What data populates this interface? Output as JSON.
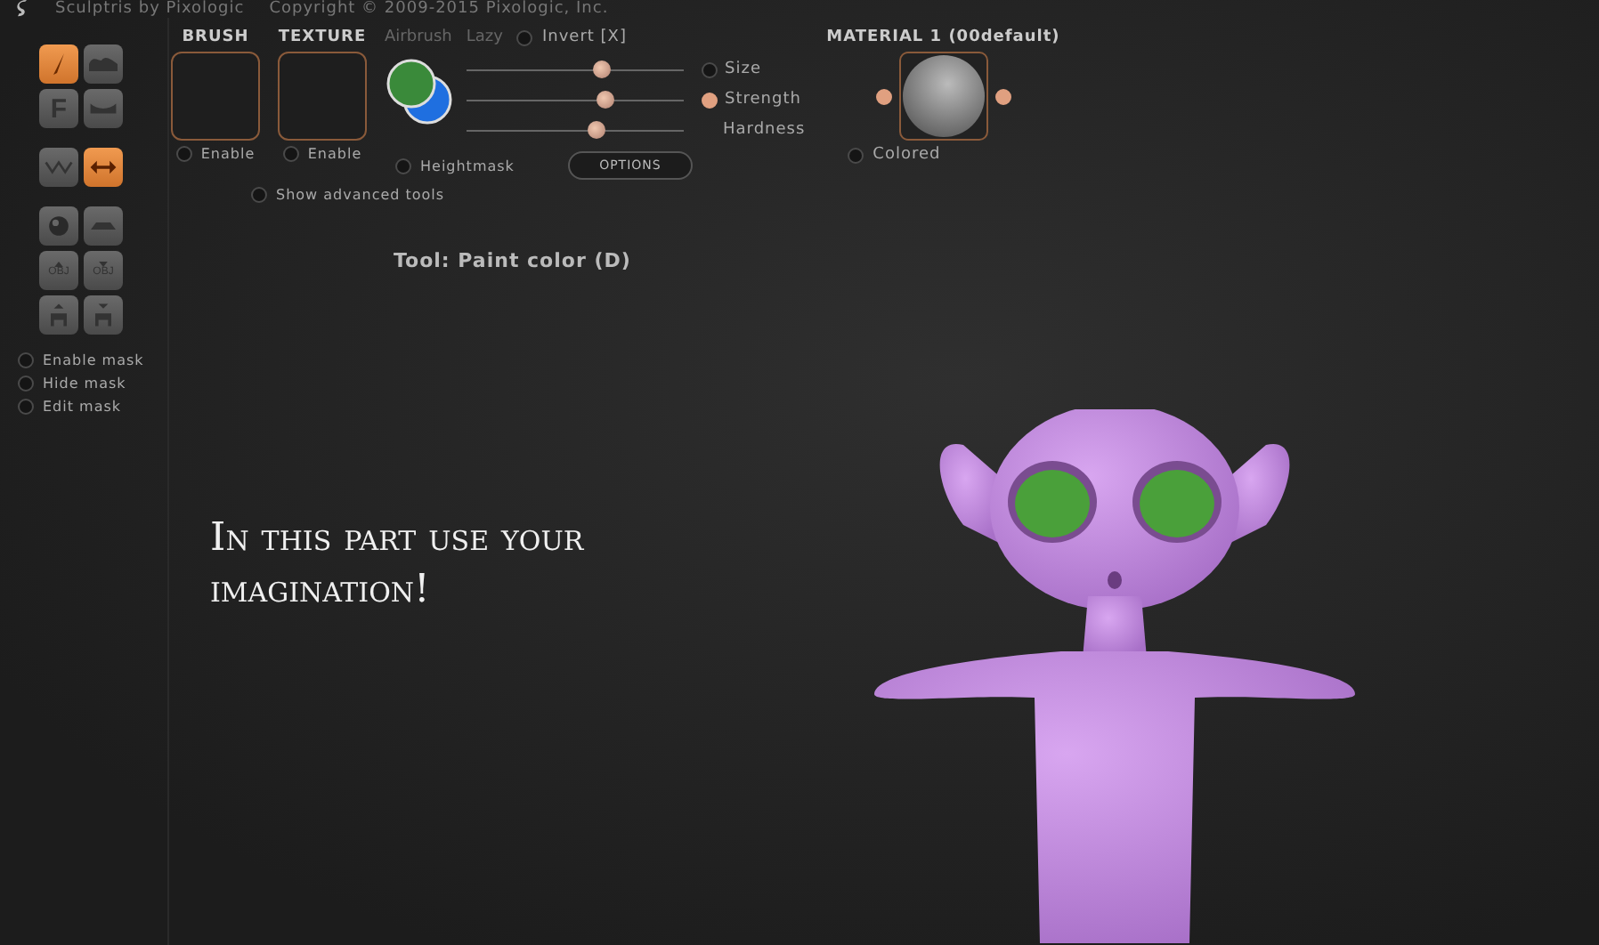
{
  "title_bar": {
    "app": "Sculptris by Pixologic",
    "copyright": "Copyright © 2009-2015 Pixologic, Inc."
  },
  "tools": [
    {
      "kind": "brush",
      "selected": true
    },
    {
      "kind": "bump",
      "selected": false
    },
    {
      "kind": "letter",
      "label": "F",
      "selected": false
    },
    {
      "kind": "dent",
      "selected": false
    },
    {
      "kind": "zigzag",
      "selected": false
    },
    {
      "kind": "arrows",
      "selected": true
    },
    {
      "kind": "sphere",
      "selected": false
    },
    {
      "kind": "plane",
      "selected": false
    },
    {
      "kind": "obj-up",
      "label": "OBJ",
      "selected": false
    },
    {
      "kind": "obj-down",
      "label": "OBJ",
      "selected": false
    },
    {
      "kind": "figure-up",
      "selected": false
    },
    {
      "kind": "figure-down",
      "selected": false
    }
  ],
  "mask_options": [
    {
      "label": "Enable mask",
      "on": false
    },
    {
      "label": "Hide mask",
      "on": false
    },
    {
      "label": "Edit mask",
      "on": false
    }
  ],
  "brush": {
    "title": "BRUSH",
    "enable": {
      "label": "Enable",
      "on": false
    }
  },
  "texture": {
    "title": "TEXTURE",
    "enable": {
      "label": "Enable",
      "on": false
    }
  },
  "modes": [
    {
      "label": "Airbrush",
      "on": false
    },
    {
      "label": "Lazy",
      "on": false
    }
  ],
  "invert": {
    "label": "Invert [X]",
    "on": false
  },
  "sliders": [
    {
      "label": "Size",
      "level": 0.62,
      "on": false
    },
    {
      "label": "Strength",
      "level": 0.64,
      "on": true
    },
    {
      "label": "Hardness",
      "level": 0.6
    }
  ],
  "heightmask": {
    "label": "Heightmask",
    "on": false
  },
  "options_button": "OPTIONS",
  "material": {
    "title": "MATERIAL 1 (00default)",
    "colored": {
      "label": "Colored",
      "on": false
    }
  },
  "advanced": {
    "label": "Show advanced tools",
    "on": false
  },
  "tool_status": "Tool: Paint color (D)",
  "overlay_text": "In this part use your imagination!"
}
